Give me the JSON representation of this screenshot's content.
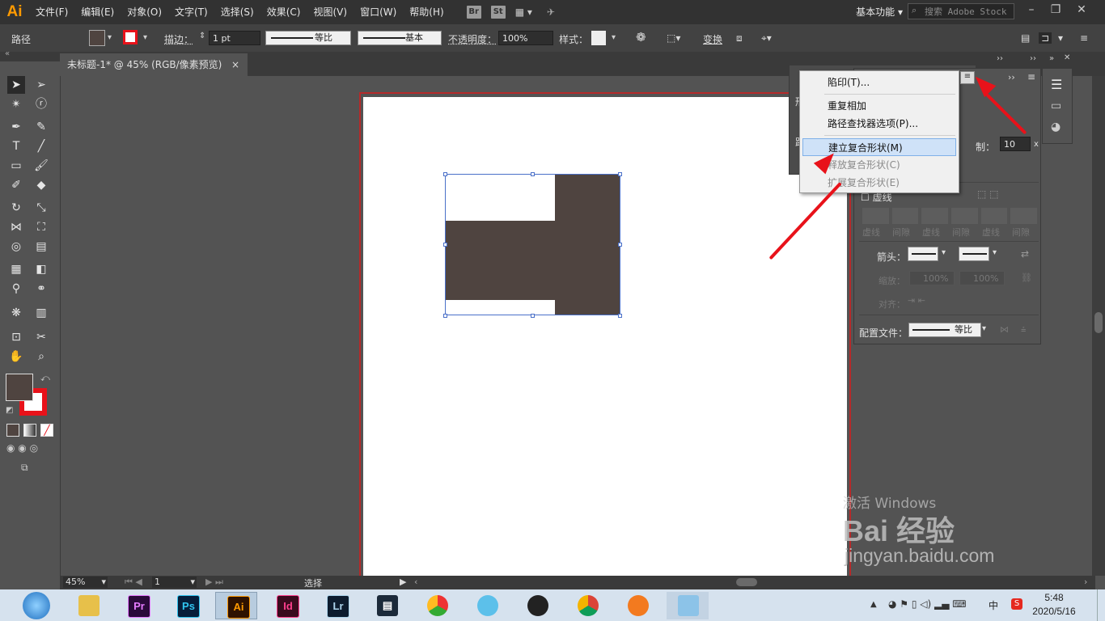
{
  "app": {
    "logo": "Ai"
  },
  "menubar": {
    "items": [
      "文件(F)",
      "编辑(E)",
      "对象(O)",
      "文字(T)",
      "选择(S)",
      "效果(C)",
      "视图(V)",
      "窗口(W)",
      "帮助(H)"
    ],
    "bridge": "Br",
    "stock": "St",
    "workspace": "基本功能",
    "search_placeholder": "搜索 Adobe Stock"
  },
  "controlbar": {
    "selection_type": "路径",
    "stroke_label": "描边：",
    "stroke_value": "1 pt",
    "profile_uniform": "等比",
    "brush_basic": "基本",
    "opacity_label": "不透明度：",
    "opacity_value": "100%",
    "style_label": "样式：",
    "transform_label": "变换"
  },
  "document": {
    "tab_title": "未标题-1* @ 45% (RGB/像素预览)",
    "close": "×"
  },
  "menu": {
    "items": [
      {
        "label": "陷印(T)...",
        "enabled": true
      },
      {
        "label": "重复相加",
        "enabled": true
      },
      {
        "label": "路径查找器选项(P)...",
        "enabled": true
      },
      {
        "label": "建立复合形状(M)",
        "enabled": true,
        "highlighted": true
      },
      {
        "label": "释放复合形状(C)",
        "enabled": false
      },
      {
        "label": "扩展复合形状(E)",
        "enabled": false
      }
    ]
  },
  "stroke_panel": {
    "limit_label": "制：",
    "limit_value": "10",
    "dashed_label": "虚线",
    "dash_cells": [
      "虚线",
      "间隙",
      "虚线",
      "间隙",
      "虚线",
      "间隙"
    ],
    "arrow_label": "箭头：",
    "scale_label": "缩放：",
    "scale_1": "100%",
    "scale_2": "100%",
    "align_label": "对齐：",
    "profile_label": "配置文件：",
    "profile_value": "等比"
  },
  "statusbar": {
    "zoom": "45%",
    "page": "1",
    "tool": "选择"
  },
  "taskbar": {
    "apps": [
      "Pr",
      "Ps",
      "Ai",
      "Id",
      "Lr"
    ],
    "ime": "中",
    "time": "5:48",
    "date": "2020/5/16"
  },
  "watermark": {
    "activate": "激活 Windows",
    "brand": "Bai 经验",
    "url": "jingyan.baidu.com"
  },
  "colors": {
    "fill": "#4f4440",
    "stroke": "#e8121a",
    "accent": "#ff9a00",
    "artboard_border": "#b52a2a"
  }
}
